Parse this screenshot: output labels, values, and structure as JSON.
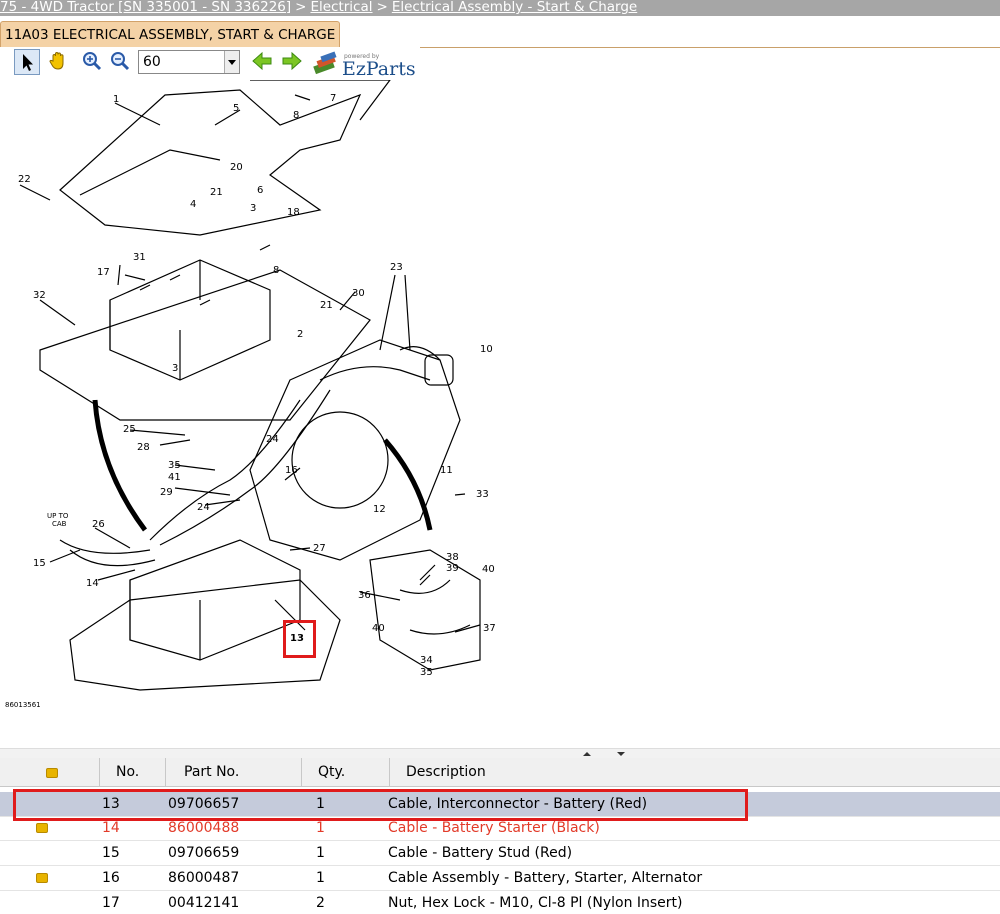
{
  "breadcrumb": {
    "item1": "75 - 4WD Tractor [SN 335001 - SN 336226]",
    "item2": "Electrical",
    "item3": "Electrical Assembly - Start & Charge",
    "separator": ">"
  },
  "tab": {
    "label": "11A03 ELECTRICAL ASSEMBLY, START & CHARGE"
  },
  "toolbar": {
    "zoom_value": "60",
    "logo_powered": "powered by",
    "logo_text": "EzParts",
    "icons": [
      "pointer-icon",
      "hand-pan-icon",
      "zoom-in-icon",
      "zoom-out-icon",
      "dropdown-arrow-icon",
      "arrow-left-icon",
      "arrow-right-icon",
      "ezparts-logo-icon"
    ]
  },
  "diagram": {
    "image_code": "86013561",
    "up_to_cab": [
      "UP TO",
      "CAB"
    ],
    "callouts": [
      "1",
      "2",
      "3",
      "3",
      "4",
      "5",
      "6",
      "7",
      "8",
      "8",
      "10",
      "11",
      "12",
      "13",
      "14",
      "15",
      "16",
      "17",
      "18",
      "20",
      "21",
      "21",
      "22",
      "23",
      "24",
      "24",
      "25",
      "26",
      "27",
      "28",
      "29",
      "30",
      "31",
      "32",
      "33",
      "34",
      "35",
      "35",
      "36",
      "37",
      "38",
      "39",
      "40",
      "40",
      "41"
    ],
    "highlighted_callout": "13"
  },
  "grid": {
    "headers": {
      "note": "",
      "no": "No.",
      "part_no": "Part No.",
      "qty": "Qty.",
      "description": "Description"
    },
    "rows": [
      {
        "note": false,
        "no": "13",
        "part_no": "09706657",
        "qty": "1",
        "description": "Cable, Interconnector - Battery (Red)",
        "selected": true,
        "red": false
      },
      {
        "note": true,
        "no": "14",
        "part_no": "86000488",
        "qty": "1",
        "description": "Cable - Battery Starter (Black)",
        "selected": false,
        "red": true
      },
      {
        "note": false,
        "no": "15",
        "part_no": "09706659",
        "qty": "1",
        "description": "Cable - Battery Stud (Red)",
        "selected": false,
        "red": false
      },
      {
        "note": true,
        "no": "16",
        "part_no": "86000487",
        "qty": "1",
        "description": "Cable Assembly - Battery, Starter, Alternator",
        "selected": false,
        "red": false
      },
      {
        "note": false,
        "no": "17",
        "part_no": "00412141",
        "qty": "2",
        "description": "Nut, Hex Lock - M10, Cl-8 Pl (Nylon Insert)",
        "selected": false,
        "red": false
      }
    ]
  },
  "colors": {
    "highlight": "#e01b1b",
    "selected_row": "#c5cbdb",
    "red_row": "#e23b2a",
    "tab": "#f4d2a6",
    "crumb_bar": "#a6a6a6"
  }
}
